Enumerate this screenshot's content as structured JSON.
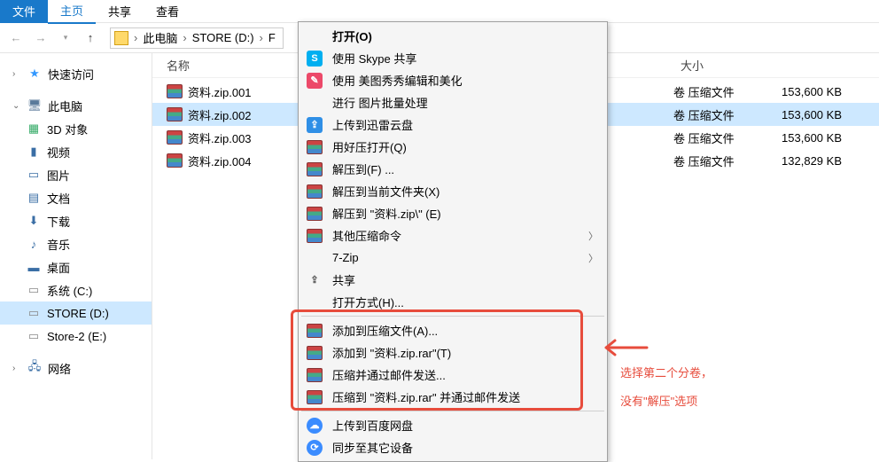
{
  "ribbon": {
    "file": "文件",
    "tabs": [
      "主页",
      "共享",
      "查看"
    ]
  },
  "breadcrumb": [
    "此电脑",
    "STORE (D:)",
    "F"
  ],
  "columns": {
    "name": "名称",
    "size": "大小"
  },
  "sidebar": {
    "quick": "快速访问",
    "pc": "此电脑",
    "pc_items": [
      "3D 对象",
      "视频",
      "图片",
      "文档",
      "下载",
      "音乐",
      "桌面",
      "系统 (C:)",
      "STORE (D:)",
      "Store-2 (E:)"
    ],
    "net": "网络"
  },
  "files": [
    {
      "name": "资料.zip.001",
      "type": "卷 压缩文件",
      "size": "153,600 KB",
      "sel": false
    },
    {
      "name": "资料.zip.002",
      "type": "卷 压缩文件",
      "size": "153,600 KB",
      "sel": true
    },
    {
      "name": "资料.zip.003",
      "type": "卷 压缩文件",
      "size": "153,600 KB",
      "sel": false
    },
    {
      "name": "资料.zip.004",
      "type": "卷 压缩文件",
      "size": "132,829 KB",
      "sel": false
    }
  ],
  "menu": {
    "open": "打开(O)",
    "skype": "使用 Skype 共享",
    "meitu": "使用 美图秀秀编辑和美化",
    "batch": "进行 图片批量处理",
    "xunlei": "上传到迅雷云盘",
    "haoya": "用好压打开(Q)",
    "extract_to": "解压到(F) ...",
    "extract_here": "解压到当前文件夹(X)",
    "extract_named": "解压到 \"资料.zip\\\" (E)",
    "other_rar": "其他压缩命令",
    "sevenzip": "7-Zip",
    "share": "共享",
    "open_with": "打开方式(H)...",
    "add_archive": "添加到压缩文件(A)...",
    "add_named": "添加到 \"资料.zip.rar\"(T)",
    "compress_mail": "压缩并通过邮件发送...",
    "compress_named_mail": "压缩到 \"资料.zip.rar\" 并通过邮件发送",
    "baidu": "上传到百度网盘",
    "sync": "同步至其它设备"
  },
  "annotation": {
    "l1": "选择第二个分卷，",
    "l2": "没有\"解压\"选项"
  }
}
